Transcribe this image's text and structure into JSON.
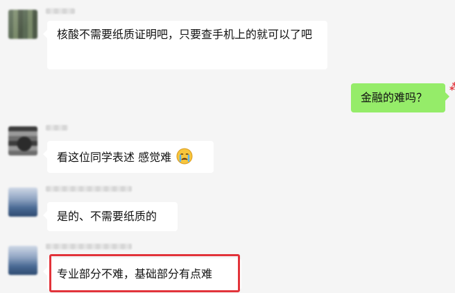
{
  "messages": [
    {
      "sender": "left",
      "text": "核酸不需要纸质证明吧，只要查手机上的就可以了吧"
    },
    {
      "sender": "right",
      "text": "金融的难吗？"
    },
    {
      "sender": "left",
      "text": "看这位同学表述 感觉难",
      "emoji": "crying-emoji"
    },
    {
      "sender": "left",
      "text": "是的、不需要纸质的"
    },
    {
      "sender": "left",
      "text": "专业部分不难，基础部分有点难",
      "highlighted": true
    }
  ],
  "colors": {
    "background": "#f5f5f5",
    "incoming_bubble": "#ffffff",
    "outgoing_bubble": "#95ec69",
    "highlight_border": "#e2333a"
  }
}
